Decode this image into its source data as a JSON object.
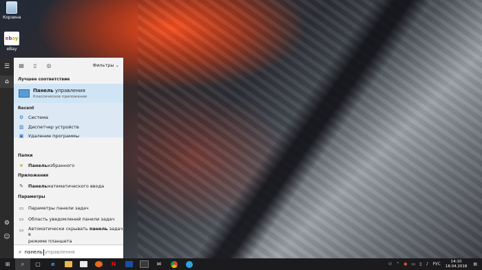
{
  "desktop": {
    "icons": [
      {
        "label": "Корзина"
      },
      {
        "label": "eBay"
      }
    ]
  },
  "search_panel": {
    "filters_label": "Фильтры",
    "best_match": {
      "header": "Лучшее соответствие",
      "title_bold": "Панель",
      "title_rest": " управления",
      "subtitle": "Классическое приложение"
    },
    "recent": {
      "header": "Recent",
      "items": [
        "Система",
        "Диспетчер устройств",
        "Удаление программы"
      ]
    },
    "folders": {
      "header": "Папки",
      "items": [
        {
          "bold": "Панель",
          "rest": " избранного"
        }
      ]
    },
    "apps": {
      "header": "Приложения",
      "items": [
        {
          "bold": "Панель",
          "rest": " математического ввода"
        }
      ]
    },
    "settings": {
      "header": "Параметры",
      "items": [
        {
          "text": "Параметры панели задач"
        },
        {
          "text": "Область уведомлений панели задач"
        },
        {
          "line1_a": "Автоматически скрывать ",
          "line1_b": "панель",
          "line1_c": " задач в",
          "line2": "режиме планшета"
        }
      ]
    },
    "query": {
      "typed": "панель",
      "suggestion": "управления"
    }
  },
  "taskbar": {
    "language": "РУС",
    "time": "14:10",
    "date": "18.04.2018"
  },
  "colors": {
    "accent": "#0078d7",
    "highlight": "#cfe4f5",
    "taskbar": "#1b1b1d"
  }
}
